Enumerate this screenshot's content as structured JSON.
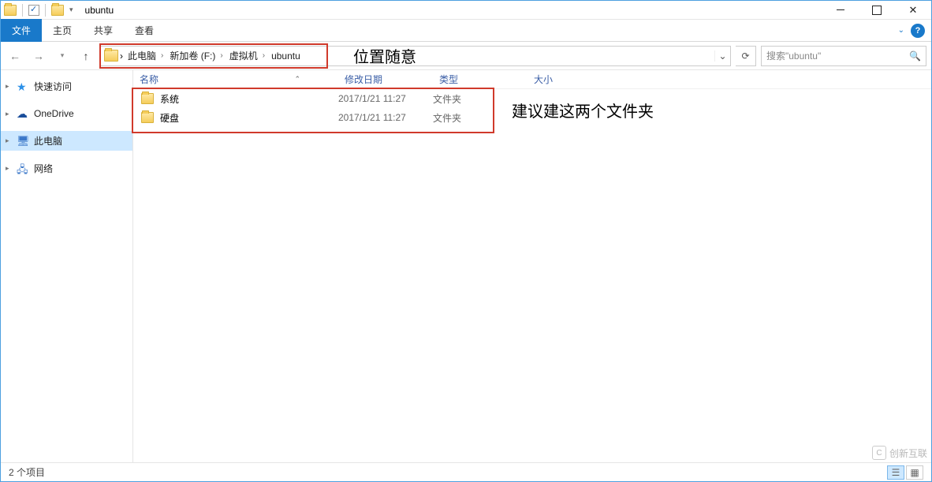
{
  "titlebar": {
    "title": "ubuntu"
  },
  "ribbon": {
    "file": "文件",
    "tabs": [
      "主页",
      "共享",
      "查看"
    ],
    "help_glyph": "?"
  },
  "nav": {
    "breadcrumb": [
      "此电脑",
      "新加卷 (F:)",
      "虚拟机",
      "ubuntu"
    ],
    "search_placeholder": "搜索\"ubuntu\"",
    "refresh_glyph": "⟳",
    "dropdown_glyph": "⌄",
    "annotation": "位置随意"
  },
  "columns": {
    "name": "名称",
    "date": "修改日期",
    "type": "类型",
    "size": "大小"
  },
  "rows": [
    {
      "name": "系统",
      "date": "2017/1/21 11:27",
      "type": "文件夹"
    },
    {
      "name": "硬盘",
      "date": "2017/1/21 11:27",
      "type": "文件夹"
    }
  ],
  "rows_annotation": "建议建这两个文件夹",
  "sidebar": {
    "items": [
      {
        "label": "快速访问",
        "icon": "star"
      },
      {
        "label": "OneDrive",
        "icon": "cloud"
      },
      {
        "label": "此电脑",
        "icon": "pc",
        "selected": true
      },
      {
        "label": "网络",
        "icon": "net"
      }
    ]
  },
  "status": {
    "text": "2 个项目"
  },
  "watermark": {
    "text": "创新互联"
  }
}
